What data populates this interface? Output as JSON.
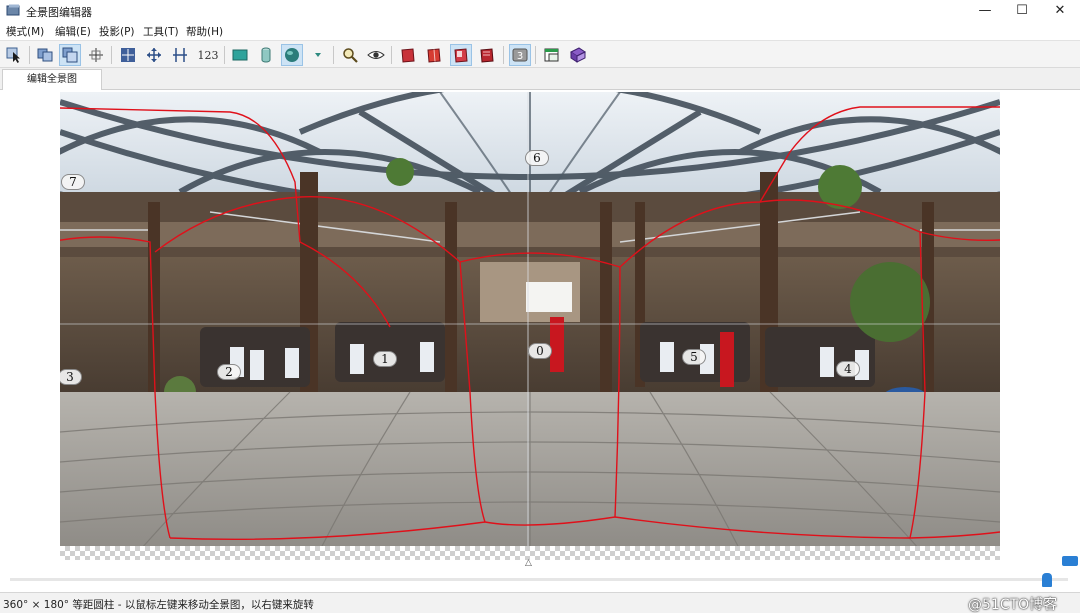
{
  "window": {
    "title": "全景图编辑器",
    "controls": {
      "minimize": "—",
      "maximize": "☐",
      "close": "✕"
    }
  },
  "menu": [
    "模式(M)",
    "编辑(E)",
    "投影(P)",
    "工具(T)",
    "帮助(H)"
  ],
  "toolbar": {
    "numeric_label": "123",
    "icons": [
      "select-pointer-icon",
      "image-overlap-icon",
      "image-active-icon",
      "crosshair-icon",
      "fit-center-icon",
      "move-horizontal-icon",
      "align-vertical-icon",
      "numbering-icon",
      "rectilinear-icon",
      "cylinder-icon",
      "sphere-icon",
      "dropdown-triangle-icon",
      "zoom-icon",
      "eye-icon",
      "color-book-1-icon",
      "color-book-2-icon",
      "color-book-3-icon",
      "color-book-4-icon",
      "layer-3-icon",
      "window-icon",
      "book-icon"
    ],
    "layer_badge": "3"
  },
  "tab": {
    "label": "编辑全景图"
  },
  "panorama": {
    "markers": [
      "0",
      "1",
      "2",
      "3",
      "4",
      "5",
      "6",
      "7"
    ],
    "outline_color": "#e0101a"
  },
  "status": {
    "text": "360° × 180° 等距圆柱 - 以鼠标左键来移动全景图，以右键来旋转"
  },
  "watermark": "@51CTO博客"
}
